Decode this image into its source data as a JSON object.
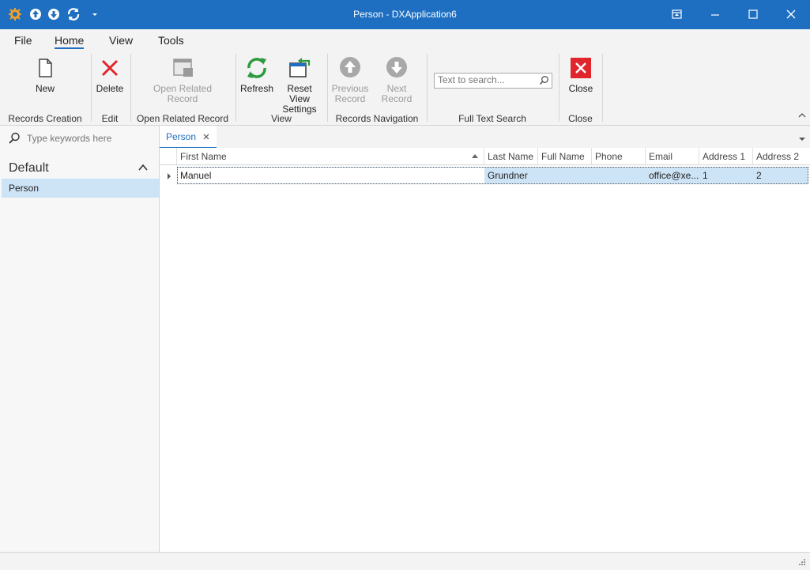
{
  "window": {
    "title": "Person - DXApplication6",
    "accent": "#1e6fc1"
  },
  "quick_access": [
    {
      "icon": "app-gear-icon"
    },
    {
      "icon": "arrow-up-circle-icon"
    },
    {
      "icon": "arrow-down-circle-icon"
    },
    {
      "icon": "refresh-icon"
    },
    {
      "icon": "dropdown-arrow-icon"
    }
  ],
  "window_buttons": [
    "restore-layout-icon",
    "minimize-icon",
    "maximize-icon",
    "close-icon"
  ],
  "ribbon": {
    "tabs": [
      {
        "label": "File",
        "active": false
      },
      {
        "label": "Home",
        "active": true
      },
      {
        "label": "View",
        "active": false
      },
      {
        "label": "Tools",
        "active": false
      }
    ],
    "buttons": {
      "new": {
        "label": "New",
        "icon": "new-document-icon"
      },
      "delete": {
        "label": "Delete",
        "icon": "delete-x-icon"
      },
      "open_related_1": "Open Related",
      "open_related_2": "Record",
      "refresh": {
        "label": "Refresh",
        "icon": "refresh-icon"
      },
      "reset_view_1": "Reset View",
      "reset_view_2": "Settings",
      "previous_1": "Previous",
      "previous_2": "Record",
      "next_record": "Next Record",
      "close": {
        "label": "Close",
        "icon": "close-red-icon"
      }
    },
    "search_placeholder": "Text to search...",
    "groups": {
      "records_creation": "Records Creation",
      "edit": "Edit",
      "open_related_record": "Open Related Record",
      "view": "View",
      "records_navigation": "Records Navigation",
      "full_text_search": "Full Text Search",
      "close": "Close"
    }
  },
  "navigation": {
    "search_placeholder": "Type keywords here",
    "group": "Default",
    "items": [
      {
        "label": "Person",
        "selected": true
      }
    ]
  },
  "document_tabs": [
    {
      "label": "Person",
      "active": true
    }
  ],
  "grid": {
    "columns": [
      "First Name",
      "Last Name",
      "Full Name",
      "Phone",
      "Email",
      "Address 1",
      "Address 2"
    ],
    "sorted_column": "First Name",
    "rows": [
      {
        "first_name": "Manuel",
        "last_name": "Grundner",
        "full_name": "",
        "phone": "",
        "email": "office@xe...",
        "address1": "1",
        "address2": "2"
      }
    ]
  }
}
